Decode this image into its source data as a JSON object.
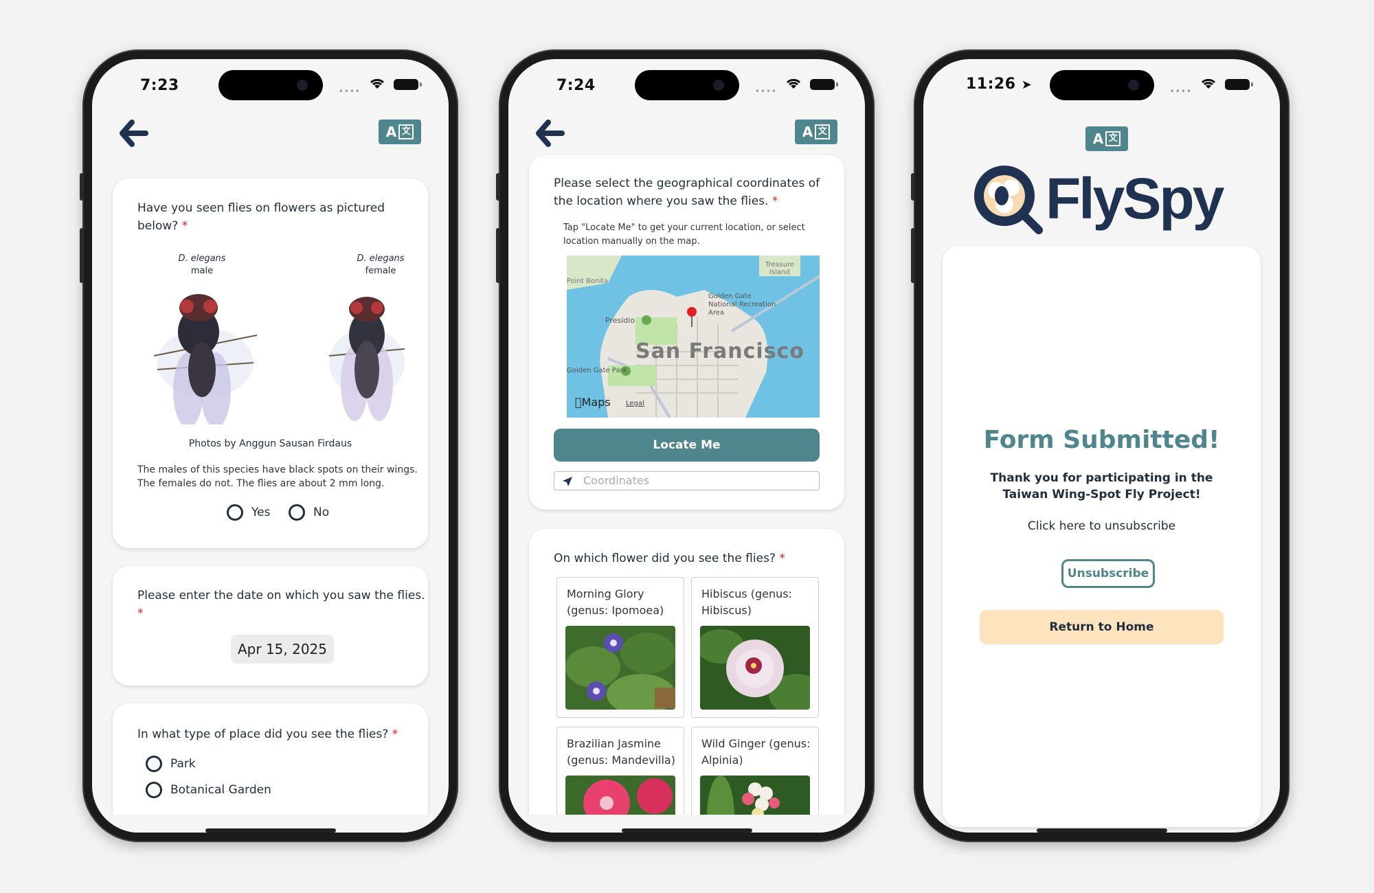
{
  "phone1": {
    "time": "7:23",
    "translate_label": "A",
    "card1": {
      "question": "Have you seen flies on flowers as pictured below?",
      "required": "*",
      "fly_male_species": "D. elegans",
      "fly_male_sex": "male",
      "fly_female_species": "D. elegans",
      "fly_female_sex": "female",
      "photo_credit": "Photos by Anggun Sausan Firdaus",
      "description": "The males of this species have black spots on their wings. The females do not. The flies are about 2 mm long.",
      "options": [
        "Yes",
        "No"
      ]
    },
    "card2": {
      "question": "Please enter the date on which you saw the flies.",
      "required": "*",
      "date_value": "Apr 15, 2025"
    },
    "card3": {
      "question": "In what type of place did you see the flies?",
      "required": "*",
      "options": [
        "Park",
        "Botanical Garden"
      ]
    }
  },
  "phone2": {
    "time": "7:24",
    "translate_label": "A",
    "card1": {
      "question": "Please select the geographical coordinates of the location where you saw the flies.",
      "required": "*",
      "hint": "Tap \"Locate Me\" to get your current location, or select location manually on the map.",
      "map_city": "San Francisco",
      "map_labels": [
        "Treasure Island",
        "Golden Gate National Recreation Area",
        "Presidio",
        "Golden Gate Park",
        "Point Bonita"
      ],
      "map_brand": "Maps",
      "map_legal": "Legal",
      "locate_button": "Locate Me",
      "coords_placeholder": "Coordinates"
    },
    "card2": {
      "question": "On which flower did you see the flies?",
      "required": "*",
      "flowers": [
        {
          "label": "Morning Glory (genus: Ipomoea)"
        },
        {
          "label": "Hibiscus (genus: Hibiscus)"
        },
        {
          "label": "Brazilian Jasmine (genus: Mandevilla)"
        },
        {
          "label": "Wild Ginger (genus: Alpinia)"
        }
      ]
    }
  },
  "phone3": {
    "time": "11:26",
    "translate_label": "A",
    "logo_text": "FlySpy",
    "title": "Form Submitted!",
    "thanks": "Thank you for participating in the Taiwan Wing-Spot Fly Project!",
    "unsubscribe_prompt": "Click here to unsubscribe",
    "unsubscribe_button": "Unsubscribe",
    "home_button": "Return to Home"
  },
  "colors": {
    "teal": "#4f868d",
    "navy": "#1f3252",
    "required": "#e02020",
    "home_button_bg": "#fde4bf",
    "background": "#f2f2f2"
  }
}
